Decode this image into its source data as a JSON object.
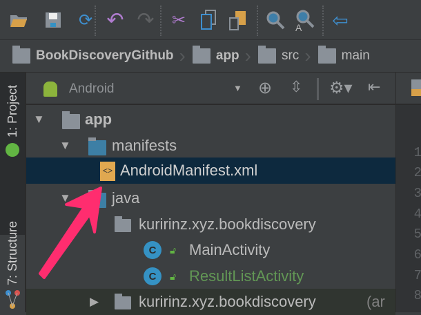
{
  "toolbar": {
    "icons": [
      "open-folder-icon",
      "save-icon",
      "sync-icon",
      "undo-icon",
      "redo-icon",
      "cut-icon",
      "copy-icon",
      "paste-icon",
      "find-icon",
      "replace-icon",
      "back-icon"
    ]
  },
  "breadcrumb": [
    "BookDiscoveryGithub",
    "app",
    "src",
    "main"
  ],
  "side_tabs": {
    "project": "1: Project",
    "structure": "7: Structure"
  },
  "panel": {
    "view_selector": "Android"
  },
  "tree": [
    {
      "label": "app",
      "expanded": true
    },
    {
      "label": "manifests",
      "expanded": true
    },
    {
      "label": "AndroidManifest.xml",
      "selected": true
    },
    {
      "label": "java",
      "expanded": true
    },
    {
      "label": "kuririnz.xyz.bookdiscovery",
      "expanded": true
    },
    {
      "label": "MainActivity",
      "icon": "C"
    },
    {
      "label": "ResultListActivity",
      "icon": "C"
    },
    {
      "label": "kuririnz.xyz.bookdiscovery",
      "suffix": "(ar",
      "expanded": false
    }
  ],
  "line_numbers": [
    "1",
    "2",
    "3",
    "4",
    "5",
    "6",
    "7",
    "8"
  ],
  "colors": {
    "accent_arrow": "#ff2d6f",
    "selection": "#0d293e",
    "green_text": "#629755"
  }
}
